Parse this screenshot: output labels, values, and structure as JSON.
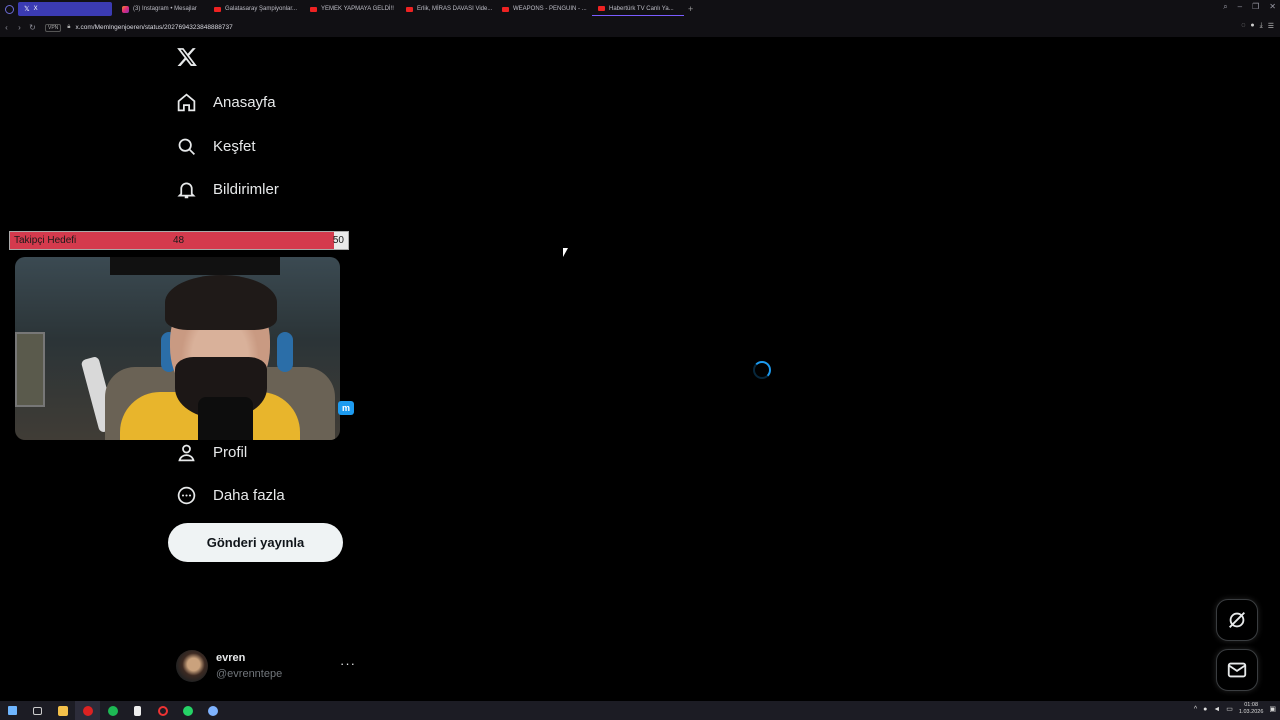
{
  "browser": {
    "tabs": [
      {
        "label": "X",
        "favicon": "x-icon"
      },
      {
        "label": "(3) Instagram • Mesajlar",
        "favicon": "instagram-icon"
      },
      {
        "label": "Galatasaray Şampiyonlar...",
        "favicon": "youtube-icon"
      },
      {
        "label": "YEMEK YAPMAYA GELDİ!!",
        "favicon": "youtube-icon"
      },
      {
        "label": "Erlik, MİRAS DAVASI Vide...",
        "favicon": "youtube-icon"
      },
      {
        "label": "WEAPONS - PENGUIN - ...",
        "favicon": "youtube-icon"
      },
      {
        "label": "Habertürk TV Canlı Ya...",
        "favicon": "youtube-icon"
      }
    ],
    "new_tab": "+",
    "vpn_label": "VPN",
    "url": "x.com/Memlngenjoeren/status/2027694323848888737"
  },
  "sidebar": {
    "items": [
      {
        "label": "Anasayfa",
        "icon": "home-icon"
      },
      {
        "label": "Keşfet",
        "icon": "search-icon"
      },
      {
        "label": "Bildirimler",
        "icon": "bell-icon"
      },
      {
        "label": "Profil",
        "icon": "person-icon"
      },
      {
        "label": "Daha fazla",
        "icon": "more-circle-icon"
      }
    ],
    "post_button": "Gönderi yayınla"
  },
  "account": {
    "name": "evren",
    "handle": "@evrenntepe",
    "more": "···"
  },
  "overlay": {
    "goal_label": "Takipçi Hedefi",
    "goal_current": "48",
    "goal_target": "50",
    "goal_progress": 0.96,
    "badge": "m"
  },
  "taskbar": {
    "time": "01:08",
    "date": "1.03.2026"
  },
  "colors": {
    "accent": "#1d9bf0",
    "goal_fill": "#d43a4d",
    "background": "#000000"
  }
}
